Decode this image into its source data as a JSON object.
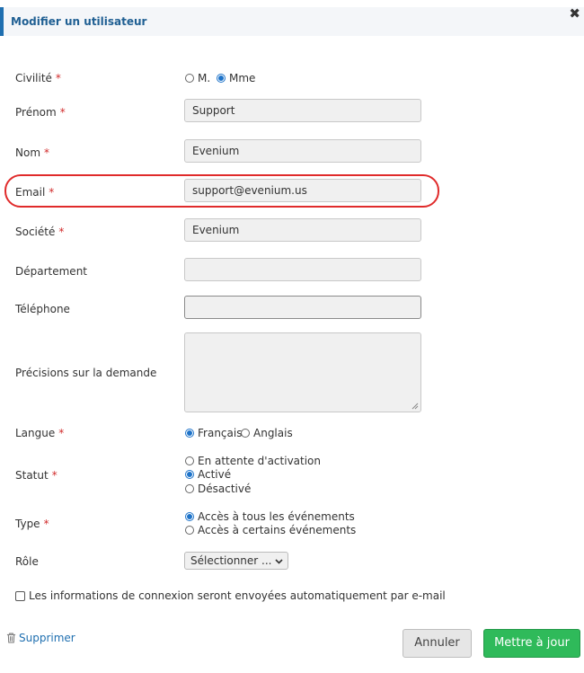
{
  "dialog": {
    "title": "Modifier un utilisateur",
    "close_icon": "close-icon"
  },
  "fields": {
    "civilite": {
      "label": "Civilité",
      "options": [
        "M.",
        "Mme"
      ],
      "selected": "Mme"
    },
    "prenom": {
      "label": "Prénom",
      "value": "Support"
    },
    "nom": {
      "label": "Nom",
      "value": "Evenium"
    },
    "email": {
      "label": "Email",
      "value": "support@evenium.us"
    },
    "societe": {
      "label": "Société",
      "value": "Evenium"
    },
    "departement": {
      "label": "Département",
      "value": ""
    },
    "telephone": {
      "label": "Téléphone",
      "value": ""
    },
    "precisions": {
      "label": "Précisions sur la demande",
      "value": ""
    },
    "langue": {
      "label": "Langue",
      "options": [
        "Français",
        "Anglais"
      ],
      "selected": "Français"
    },
    "statut": {
      "label": "Statut",
      "options": [
        "En attente d'activation",
        "Activé",
        "Désactivé"
      ],
      "selected": "Activé"
    },
    "type": {
      "label": "Type",
      "options": [
        "Accès à tous les événements",
        "Accès à certains événements"
      ],
      "selected": "Accès à tous les événements"
    },
    "role": {
      "label": "Rôle",
      "select_value": "Sélectionner ..."
    }
  },
  "required_marker": "*",
  "notification_checkbox": {
    "label": "Les informations de connexion seront envoyées automatiquement par e-mail",
    "checked": false
  },
  "footer": {
    "delete_label": "Supprimer",
    "cancel_label": "Annuler",
    "save_label": "Mettre à jour"
  },
  "colors": {
    "accent": "#1f6fb0",
    "required": "#d12b2b",
    "highlight": "#e02b2b",
    "save_button": "#2fba5a",
    "radio_on": "#1e73c9"
  }
}
